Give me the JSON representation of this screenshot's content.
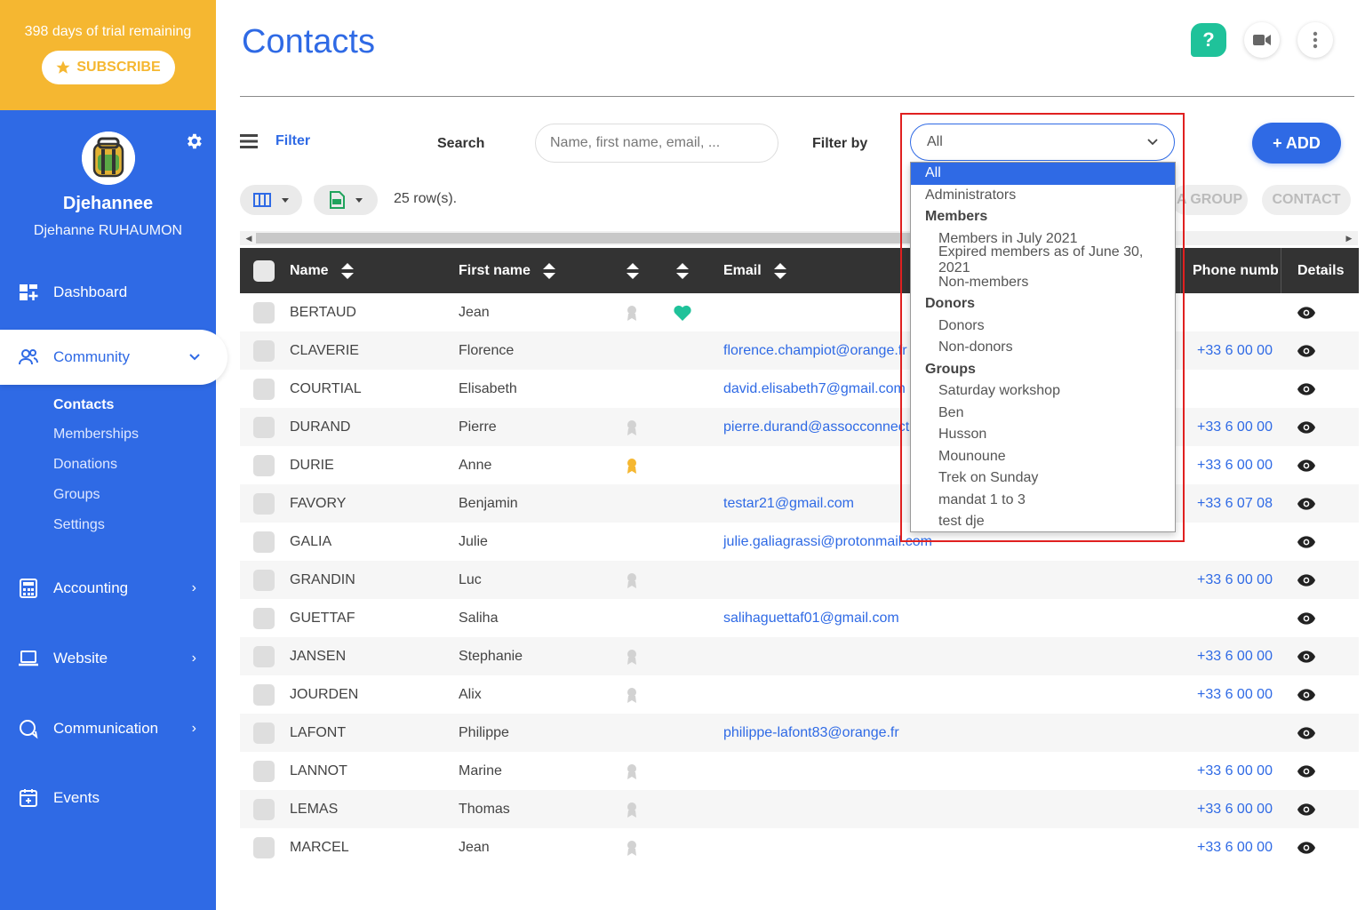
{
  "trial": {
    "text": "398 days of trial remaining",
    "subscribe_label": "SUBSCRIBE"
  },
  "profile": {
    "org_name": "Djehannee",
    "user_name": "Djehanne RUHAUMON"
  },
  "nav": {
    "dashboard": "Dashboard",
    "community": "Community",
    "community_sub": [
      "Contacts",
      "Memberships",
      "Donations",
      "Groups",
      "Settings"
    ],
    "accounting": "Accounting",
    "website": "Website",
    "communication": "Communication",
    "events": "Events"
  },
  "header": {
    "title": "Contacts",
    "help_label": "?"
  },
  "toolbar": {
    "filter_label": "Filter",
    "search_label": "Search",
    "search_placeholder": "Name, first name, email, ...",
    "filter_by_label": "Filter by",
    "filter_by_value": "All",
    "add_label": "+ ADD",
    "rows_count": "25 row(s).",
    "group_btn": "A GROUP",
    "contact_btn": "CONTACT"
  },
  "table": {
    "headers": {
      "name": "Name",
      "first_name": "First name",
      "email": "Email",
      "phone": "Phone numb",
      "details": "Details"
    },
    "rows": [
      {
        "name": "BERTAUD",
        "first": "Jean",
        "email": "",
        "phone": "",
        "badge": "grey",
        "heart": true
      },
      {
        "name": "CLAVERIE",
        "first": "Florence",
        "email": "florence.champiot@orange.fr",
        "phone": "+33 6 00 00",
        "badge": "",
        "heart": false
      },
      {
        "name": "COURTIAL",
        "first": "Elisabeth",
        "email": "david.elisabeth7@gmail.com",
        "phone": "",
        "badge": "",
        "heart": false
      },
      {
        "name": "DURAND",
        "first": "Pierre",
        "email": "pierre.durand@assocconnect.co",
        "phone": "+33 6 00 00",
        "badge": "grey",
        "heart": false
      },
      {
        "name": "DURIE",
        "first": "Anne",
        "email": "",
        "phone": "+33 6 00 00",
        "badge": "gold",
        "heart": false
      },
      {
        "name": "FAVORY",
        "first": "Benjamin",
        "email": "testar21@gmail.com",
        "phone": "+33 6 07 08",
        "badge": "",
        "heart": false
      },
      {
        "name": "GALIA",
        "first": "Julie",
        "email": "julie.galiagrassi@protonmail.com",
        "phone": "",
        "badge": "",
        "heart": false
      },
      {
        "name": "GRANDIN",
        "first": "Luc",
        "email": "",
        "phone": "+33 6 00 00",
        "badge": "grey",
        "heart": false
      },
      {
        "name": "GUETTAF",
        "first": "Saliha",
        "email": "salihaguettaf01@gmail.com",
        "phone": "",
        "badge": "",
        "heart": false
      },
      {
        "name": "JANSEN",
        "first": "Stephanie",
        "email": "",
        "phone": "+33 6 00 00",
        "badge": "grey",
        "heart": false
      },
      {
        "name": "JOURDEN",
        "first": "Alix",
        "email": "",
        "phone": "+33 6 00 00",
        "badge": "grey",
        "heart": false
      },
      {
        "name": "LAFONT",
        "first": "Philippe",
        "email": "philippe-lafont83@orange.fr",
        "phone": "",
        "badge": "",
        "heart": false
      },
      {
        "name": "LANNOT",
        "first": "Marine",
        "email": "",
        "phone": "+33 6 00 00",
        "badge": "grey",
        "heart": false
      },
      {
        "name": "LEMAS",
        "first": "Thomas",
        "email": "",
        "phone": "+33 6 00 00",
        "badge": "grey",
        "heart": false
      },
      {
        "name": "MARCEL",
        "first": "Jean",
        "email": "",
        "phone": "+33 6 00 00",
        "badge": "grey",
        "heart": false
      }
    ]
  },
  "dropdown": {
    "options": [
      {
        "label": "All",
        "kind": "option",
        "selected": true
      },
      {
        "label": "Administrators",
        "kind": "option"
      },
      {
        "label": "Members",
        "kind": "group"
      },
      {
        "label": "Members in July 2021",
        "kind": "child"
      },
      {
        "label": "Expired members as of June 30, 2021",
        "kind": "child"
      },
      {
        "label": "Non-members",
        "kind": "child"
      },
      {
        "label": "Donors",
        "kind": "group"
      },
      {
        "label": "Donors",
        "kind": "child"
      },
      {
        "label": "Non-donors",
        "kind": "child"
      },
      {
        "label": "Groups",
        "kind": "group"
      },
      {
        "label": "Saturday workshop",
        "kind": "child"
      },
      {
        "label": "Ben",
        "kind": "child"
      },
      {
        "label": "Husson",
        "kind": "child"
      },
      {
        "label": "Mounoune",
        "kind": "child"
      },
      {
        "label": "Trek on Sunday",
        "kind": "child"
      },
      {
        "label": "mandat 1 to 3",
        "kind": "child"
      },
      {
        "label": "test dje",
        "kind": "child"
      }
    ]
  },
  "colors": {
    "brand": "#2f6ae5",
    "trial": "#f5b731",
    "help": "#1fc29a",
    "highlight": "#e02020"
  }
}
